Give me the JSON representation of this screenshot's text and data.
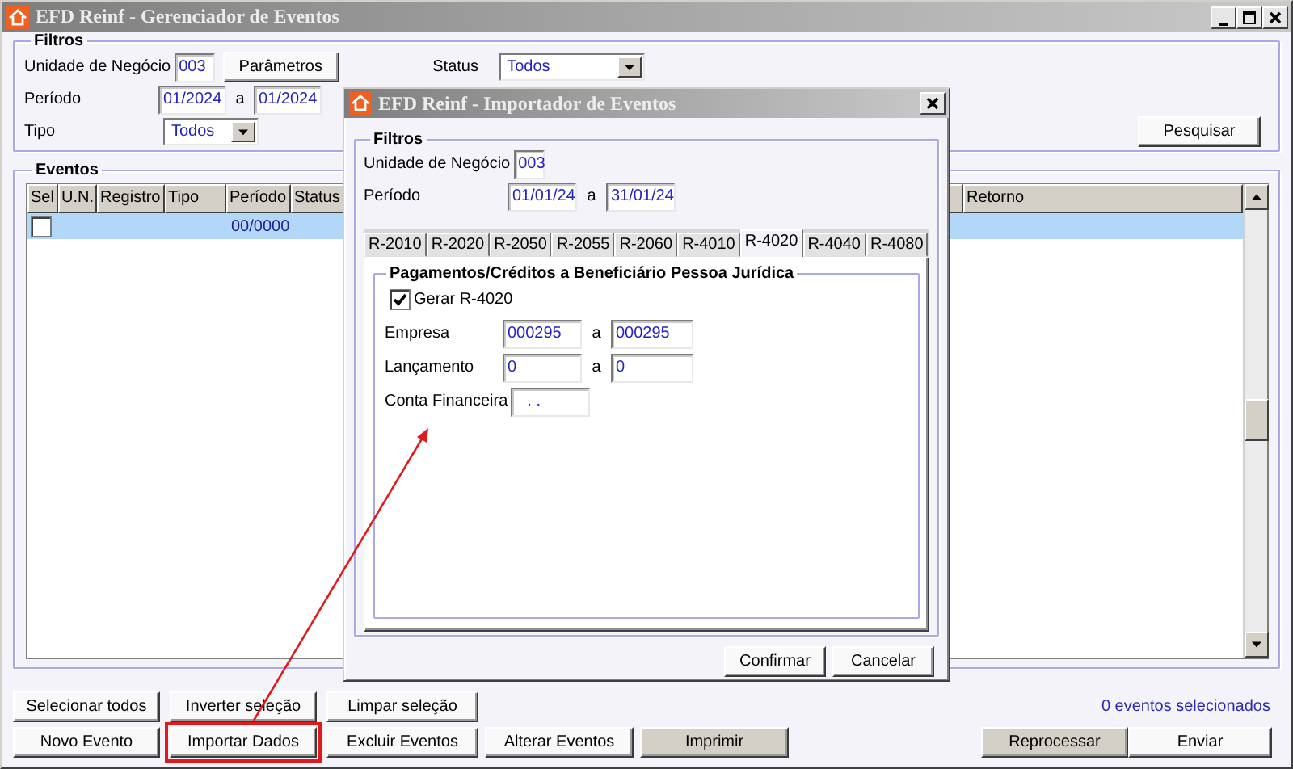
{
  "window": {
    "title": "EFD Reinf - Gerenciador de Eventos"
  },
  "filters": {
    "title": "Filtros",
    "unit_label": "Unidade de Negócio",
    "unit_value": "003",
    "params_button": "Parâmetros",
    "status_label": "Status",
    "status_value": "Todos",
    "period_label": "Período",
    "period_from": "01/2024",
    "period_sep": "a",
    "period_to": "01/2024",
    "type_label": "Tipo",
    "type_value": "Todos",
    "search_button": "Pesquisar"
  },
  "events": {
    "title": "Eventos",
    "columns": [
      "Sel",
      "U.N.",
      "Registro",
      "Tipo",
      "Período",
      "Status",
      "Retorno"
    ],
    "rows": [
      {
        "checked": false,
        "selected": true,
        "period": "00/0000"
      }
    ]
  },
  "selection_buttons": [
    {
      "label": "Selecionar todos"
    },
    {
      "label": "Inverter seleção"
    },
    {
      "label": "Limpar seleção"
    }
  ],
  "selection_count": "0 eventos selecionados",
  "action_buttons": [
    {
      "label": "Novo Evento",
      "disabled": false,
      "highlighted": false
    },
    {
      "label": "Importar Dados",
      "disabled": false,
      "highlighted": true
    },
    {
      "label": "Excluir Eventos",
      "disabled": false,
      "highlighted": false
    },
    {
      "label": "Alterar Eventos",
      "disabled": false,
      "highlighted": false
    },
    {
      "label": "Imprimir",
      "disabled": true,
      "highlighted": false
    }
  ],
  "send_buttons": [
    {
      "label": "Reprocessar",
      "disabled": true
    },
    {
      "label": "Enviar",
      "disabled": false
    }
  ],
  "dialog": {
    "title": "EFD Reinf - Importador de Eventos",
    "filters_title": "Filtros",
    "unit_label": "Unidade de Negócio",
    "unit_value": "003",
    "period_label": "Período",
    "period_from": "01/01/24",
    "period_sep": "a",
    "period_to": "31/01/24",
    "tabs": [
      {
        "label": "R-2010",
        "selected": false
      },
      {
        "label": "R-2020",
        "selected": false
      },
      {
        "label": "R-2050",
        "selected": false
      },
      {
        "label": "R-2055",
        "selected": false
      },
      {
        "label": "R-2060",
        "selected": false
      },
      {
        "label": "R-4010",
        "selected": false
      },
      {
        "label": "R-4020",
        "selected": true
      },
      {
        "label": "R-4040",
        "selected": false
      },
      {
        "label": "R-4080",
        "selected": false
      }
    ],
    "section": {
      "title": "Pagamentos/Créditos a Beneficiário Pessoa Jurídica",
      "generate_label": "Gerar R-4020",
      "generate_checked": true,
      "fields": [
        {
          "label": "Empresa",
          "from": "000295",
          "sep": "a",
          "to": "000295"
        },
        {
          "label": "Lançamento",
          "from": "0",
          "sep": "a",
          "to": "0"
        },
        {
          "label": "Conta Financeira",
          "from": ". ."
        }
      ]
    },
    "buttons": [
      {
        "label": "Confirmar"
      },
      {
        "label": "Cancelar"
      }
    ]
  }
}
